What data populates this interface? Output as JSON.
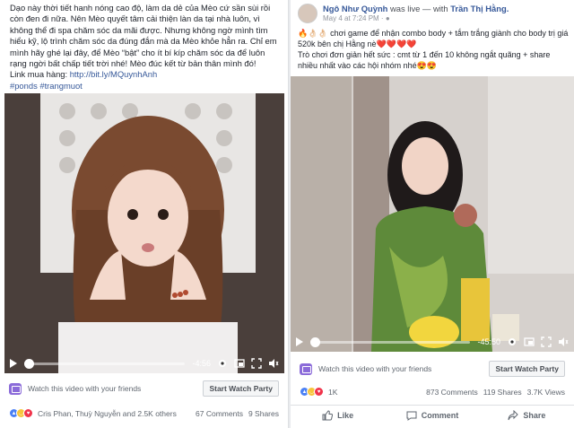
{
  "left_post": {
    "caption_main": "Dạo này thời tiết hanh nóng cao độ, làm da dẻ của Mèo cứ sần sùi rồi còn đen đi nữa. Nên Mèo quyết tâm cải thiện làn da tại nhà luôn, vì không thể đi spa chăm sóc da mãi được. Nhưng không ngờ mình tìm hiểu kỹ, lộ trình chăm sóc da đúng đắn mà da Mèo khỏe hẳn ra. Chỉ em mình hãy ghé lại đây, để Mèo “bật” cho ít bí kíp chăm sóc da để luôn rạng ngời bất chấp tiết trời nhé! Mèo đúc kết từ bản thân mình đó!",
    "link_prefix": "Link mua hàng: ",
    "link": "http://bit.ly/MQuynhAnh",
    "hashtags": "#ponds #trangmuot",
    "video_time": "-4:56",
    "watch_text": "Watch this video with your friends",
    "watch_button": "Start Watch Party",
    "reactions_names": "Cris Phan, Thuỳ Nguyễn and 2.5K others",
    "comments": "67 Comments",
    "shares": "9 Shares"
  },
  "right_post": {
    "author": "Ngô Như Quỳnh",
    "live_text": " was live — with ",
    "with_name": "Trần Thị Hằng.",
    "date": "May 4 at 7:24 PM",
    "body_line1": "🔥👌🏻👌🏻 chơi game để nhận combo body + tắm trắng giành cho body trị giá 520k bên chị Hằng nè❤️❤️❤️❤️",
    "body_line2": "Trò chơi đơn giản hết sức : cmt từ 1 đến 10 không ngắt quãng + share nhiều nhất vào các hội nhóm nhé😍😍",
    "video_time": "-45:50",
    "watch_text": "Watch this video with your friends",
    "watch_button": "Start Watch Party",
    "reaction_count": "1K",
    "comments": "873 Comments",
    "shares": "119 Shares",
    "views": "3.7K Views",
    "actions": {
      "like": "Like",
      "comment": "Comment",
      "share": "Share"
    }
  },
  "colors": {
    "link": "#365899",
    "party": "#8b6bd9",
    "like": "#4a80f5",
    "love": "#f0334a",
    "haha": "#f7c53b"
  }
}
